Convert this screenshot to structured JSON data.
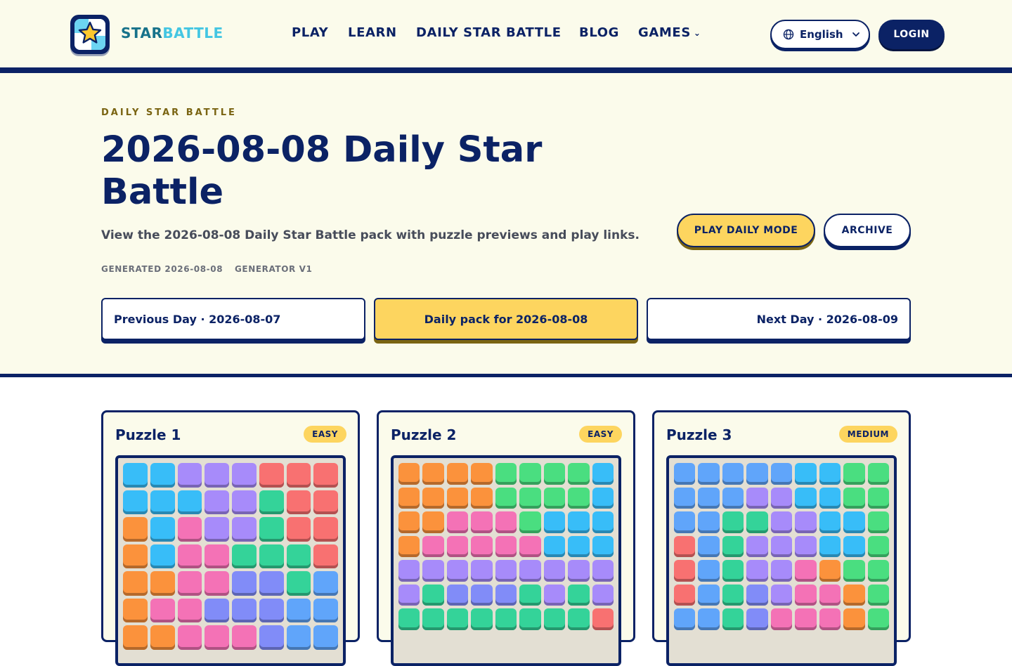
{
  "brand": {
    "name_part1": "STAR",
    "name_part2": "BATTLE",
    "logo_icon": "star-logo-icon"
  },
  "nav": {
    "play": "PLAY",
    "learn": "LEARN",
    "daily": "DAILY STAR BATTLE",
    "blog": "BLOG",
    "games": "GAMES",
    "games_caret": "⌄"
  },
  "header": {
    "language": "English",
    "login": "LOGIN"
  },
  "hero": {
    "eyebrow": "DAILY STAR BATTLE",
    "title": "2026-08-08 Daily Star Battle",
    "subtitle": "View the 2026-08-08 Daily Star Battle pack with puzzle previews and play links.",
    "meta_generated": "GENERATED 2026-08-08",
    "meta_generator": "GENERATOR V1",
    "play_daily": "PLAY DAILY MODE",
    "archive": "ARCHIVE",
    "prev_day": "Previous Day · 2026-08-07",
    "current_day": "Daily pack for 2026-08-08",
    "next_day": "Next Day · 2026-08-09"
  },
  "colors": {
    "navy": "#0b2265",
    "cream": "#fbfbeb",
    "yellow": "#fdd55f",
    "palette": {
      "b": "#38bdf8",
      "v": "#a78bfa",
      "r": "#f87171",
      "g": "#34d399",
      "o": "#fb923c",
      "p": "#f472b6",
      "i": "#818cf8",
      "s": "#60a5fa",
      "l": "#4ade80"
    }
  },
  "puzzles": [
    {
      "title": "Puzzle 1",
      "difficulty": "EASY",
      "size": 8,
      "rows": [
        "bbvvvrrr",
        "bbbvvgrr",
        "obpvvgrr",
        "obppgggr",
        "ooppiigs",
        "oppiiiss",
        "oopppiss"
      ]
    },
    {
      "title": "Puzzle 2",
      "difficulty": "EASY",
      "size": 9,
      "rows": [
        "oooollllb",
        "oooollllb",
        "ooppplbbb",
        "opppppbb",
        "vvvvvvvvv",
        "vgiiigvgv",
        "ggggggggr"
      ]
    },
    {
      "title": "Puzzle 3",
      "difficulty": "MEDIUM",
      "size": 9,
      "rows": [
        "sssssbbll",
        "sssvvbbll",
        "ssggvvbbl",
        "rsgvvvbbl",
        "rsgvvpol",
        "rsgivppol",
        "ssgipppol"
      ]
    }
  ]
}
